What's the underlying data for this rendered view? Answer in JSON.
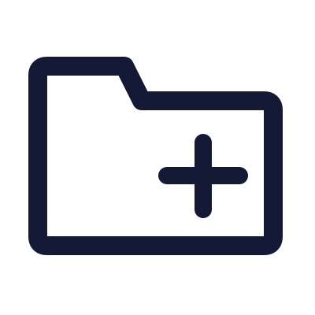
{
  "icon": {
    "name": "folder-add-icon",
    "stroke_color": "#141936",
    "background_color": "#ffffff"
  }
}
